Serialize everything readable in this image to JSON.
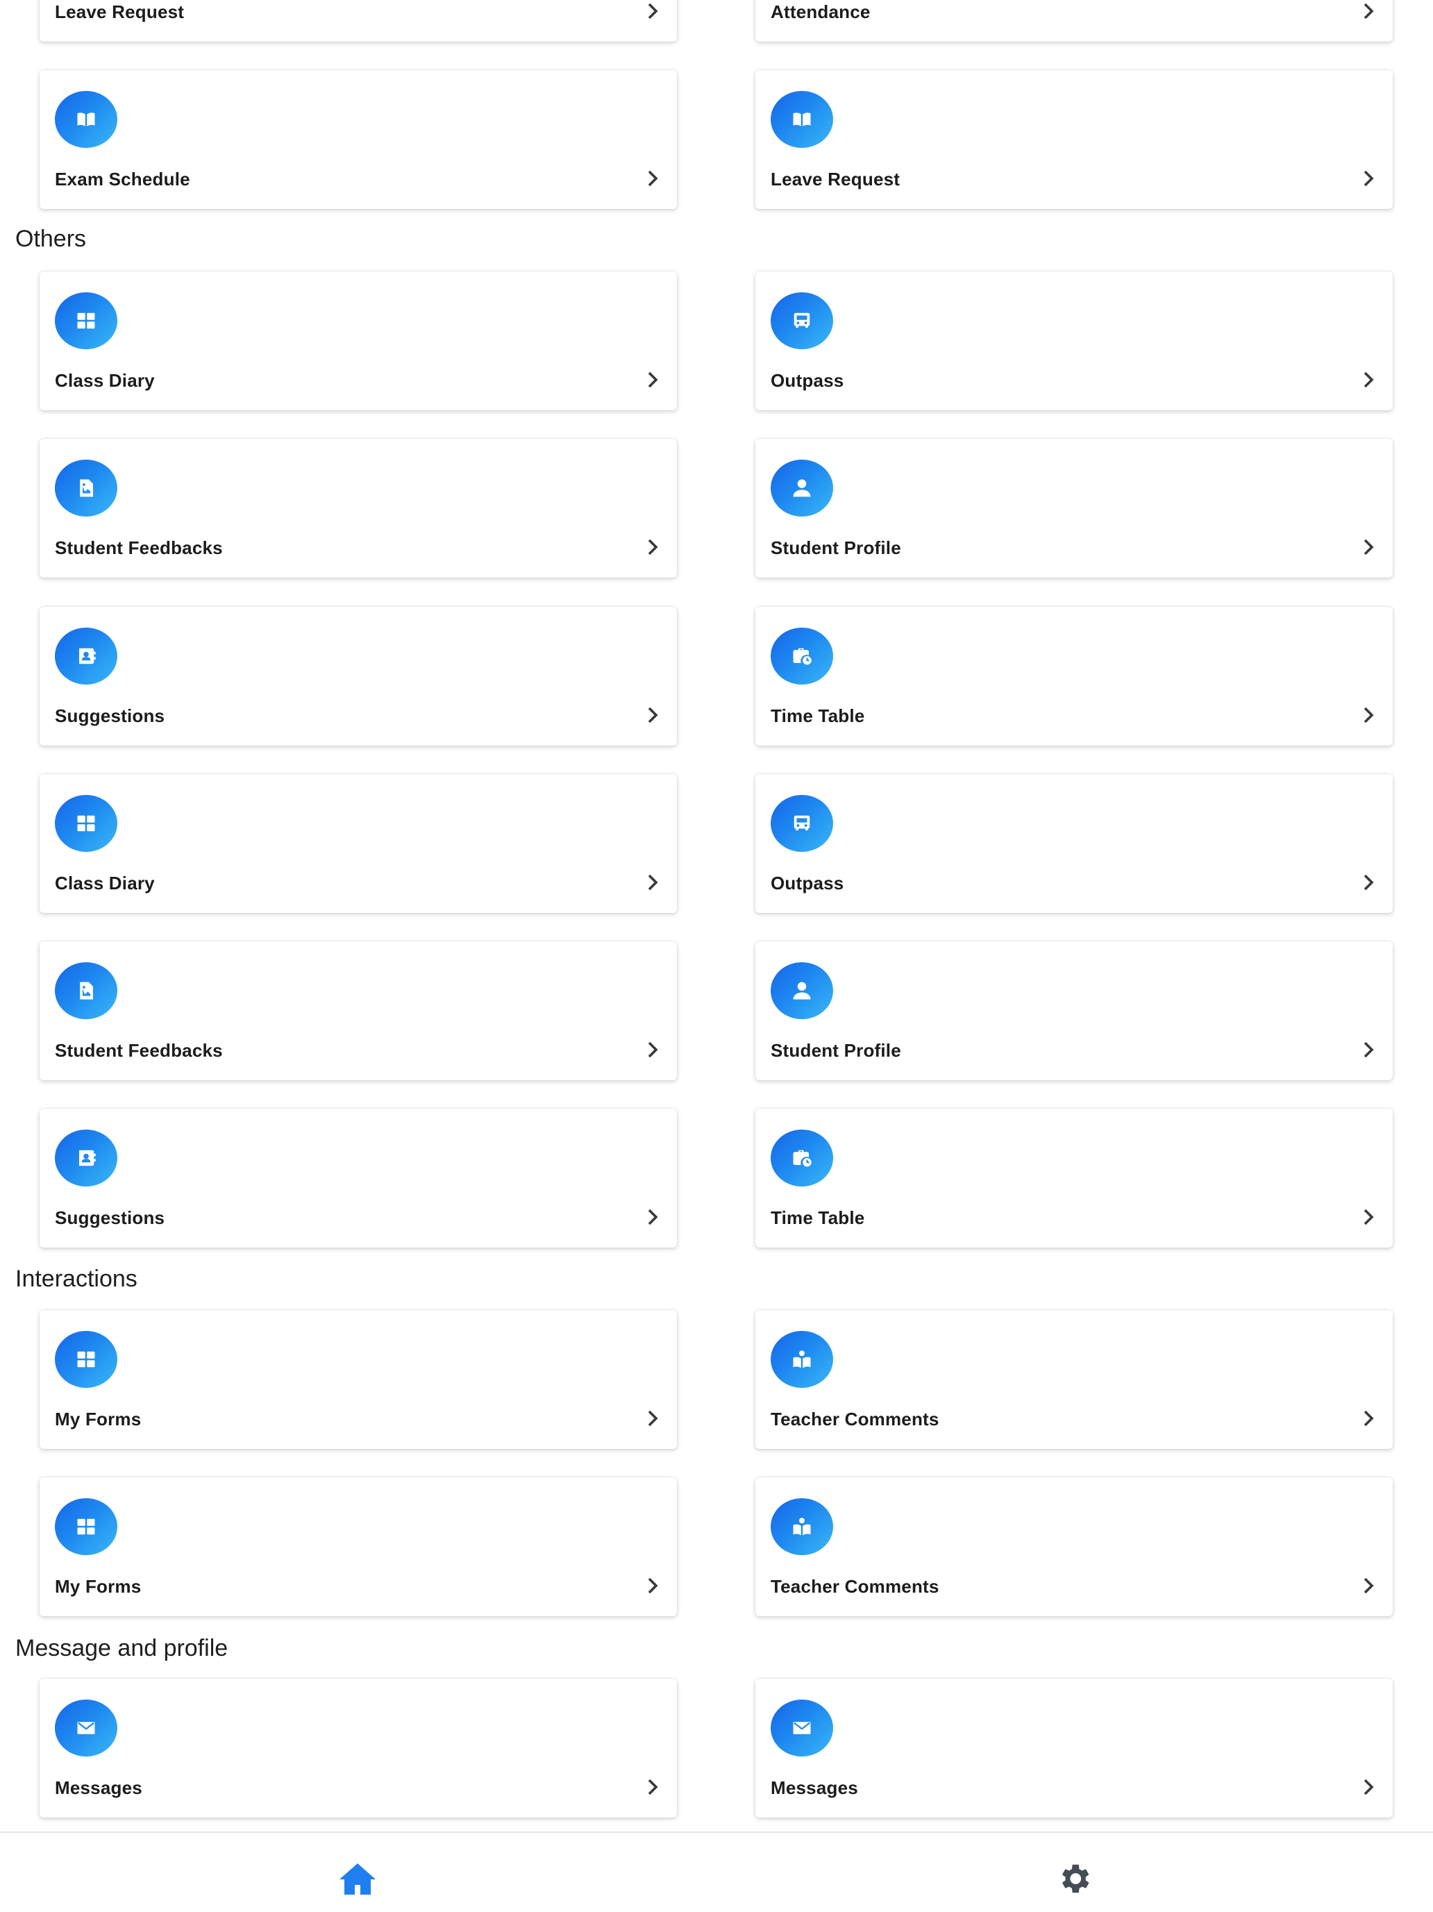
{
  "sections": [
    {
      "title": "Others",
      "y": 0
    },
    {
      "title": "Interactions",
      "y": 0
    },
    {
      "title": "Message and profile",
      "y": 0
    }
  ],
  "cards": [
    {
      "label": "Leave Request",
      "icon": "none"
    },
    {
      "label": "Attendance",
      "icon": "none"
    },
    {
      "label": "Exam Schedule",
      "icon": "book-open-icon"
    },
    {
      "label": "Leave Request",
      "icon": "book-open-icon"
    },
    {
      "label": "Class Diary",
      "icon": "grid-icon"
    },
    {
      "label": "Outpass",
      "icon": "bus-icon"
    },
    {
      "label": "Student Feedbacks",
      "icon": "feedback-image-icon"
    },
    {
      "label": "Student Profile",
      "icon": "user-icon"
    },
    {
      "label": "Suggestions",
      "icon": "contact-book-icon"
    },
    {
      "label": "Time Table",
      "icon": "briefcase-clock-icon"
    },
    {
      "label": "Class Diary",
      "icon": "grid-icon"
    },
    {
      "label": "Outpass",
      "icon": "bus-icon"
    },
    {
      "label": "Student Feedbacks",
      "icon": "feedback-image-icon"
    },
    {
      "label": "Student Profile",
      "icon": "user-icon"
    },
    {
      "label": "Suggestions",
      "icon": "contact-book-icon"
    },
    {
      "label": "Time Table",
      "icon": "briefcase-clock-icon"
    },
    {
      "label": "My Forms",
      "icon": "grid-icon"
    },
    {
      "label": "Teacher Comments",
      "icon": "reader-icon"
    },
    {
      "label": "My Forms",
      "icon": "grid-icon"
    },
    {
      "label": "Teacher Comments",
      "icon": "reader-icon"
    },
    {
      "label": "Messages",
      "icon": "envelope-icon"
    },
    {
      "label": "Messages",
      "icon": "envelope-icon"
    }
  ],
  "bottom_nav": [
    {
      "icon": "home-icon",
      "active": true
    },
    {
      "icon": "gear-icon",
      "active": false
    }
  ],
  "colors": {
    "accent": "#1e88f0",
    "home_active": "#1f7ff0",
    "gear": "#444c55"
  }
}
